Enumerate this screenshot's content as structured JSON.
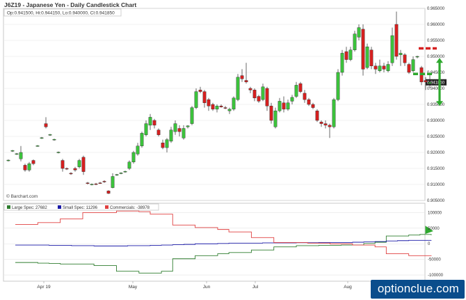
{
  "title": "J6Z19 - Japanese Yen - Daily Candlestick Chart",
  "ohlc_legend": "Op:0.941500, Hi:0.944150, Lo:0.940000, Cl:0.941850",
  "source_label": "© Barchart.com",
  "last_price_label": "0.941850",
  "watermark": "optionclue.com",
  "colors": {
    "up": "#3cc33c",
    "down": "#d62020",
    "large_spec": "#2e7d2e",
    "small_spec": "#1a1aa8",
    "commercials": "#e04040",
    "annotation": "#2ea82e",
    "resistance": "#d62020",
    "support": "#2ea82e",
    "grid": "#e4e4e4",
    "label_bg": "#222222"
  },
  "chart_data": [
    {
      "type": "candlestick",
      "y_ticks": [
        "0.965000",
        "0.960000",
        "0.955000",
        "0.950000",
        "0.945000",
        "0.940000",
        "0.935000",
        "0.930000",
        "0.925000",
        "0.920000",
        "0.915000",
        "0.910000",
        "0.905000"
      ],
      "ylim": [
        0.905,
        0.965
      ],
      "x_ticks": [
        "Apr 19",
        "May",
        "Jun",
        "Jul",
        "Aug"
      ],
      "candles": [
        {
          "o": 0.9175,
          "h": 0.9178,
          "l": 0.9172,
          "c": 0.9176
        },
        {
          "o": 0.9205,
          "h": 0.9208,
          "l": 0.9202,
          "c": 0.9206
        },
        {
          "o": 0.9195,
          "h": 0.9198,
          "l": 0.9192,
          "c": 0.9196
        },
        {
          "o": 0.918,
          "h": 0.922,
          "l": 0.9172,
          "c": 0.92
        },
        {
          "o": 0.916,
          "h": 0.9165,
          "l": 0.914,
          "c": 0.9145
        },
        {
          "o": 0.9145,
          "h": 0.917,
          "l": 0.914,
          "c": 0.9165
        },
        {
          "o": 0.9175,
          "h": 0.9178,
          "l": 0.916,
          "c": 0.9165
        },
        {
          "o": 0.922,
          "h": 0.9223,
          "l": 0.9218,
          "c": 0.9221
        },
        {
          "o": 0.9245,
          "h": 0.9248,
          "l": 0.9242,
          "c": 0.9246
        },
        {
          "o": 0.929,
          "h": 0.931,
          "l": 0.9275,
          "c": 0.928
        },
        {
          "o": 0.9255,
          "h": 0.9258,
          "l": 0.9252,
          "c": 0.9256
        },
        {
          "o": 0.924,
          "h": 0.9243,
          "l": 0.9237,
          "c": 0.9241
        },
        {
          "o": 0.92,
          "h": 0.9203,
          "l": 0.9197,
          "c": 0.9201
        },
        {
          "o": 0.9175,
          "h": 0.918,
          "l": 0.914,
          "c": 0.915
        },
        {
          "o": 0.915,
          "h": 0.9153,
          "l": 0.9145,
          "c": 0.9148
        },
        {
          "o": 0.9135,
          "h": 0.9138,
          "l": 0.913,
          "c": 0.9133
        },
        {
          "o": 0.915,
          "h": 0.9155,
          "l": 0.914,
          "c": 0.9145
        },
        {
          "o": 0.9155,
          "h": 0.918,
          "l": 0.915,
          "c": 0.9175
        },
        {
          "o": 0.9185,
          "h": 0.919,
          "l": 0.913,
          "c": 0.914
        },
        {
          "o": 0.9105,
          "h": 0.9108,
          "l": 0.91,
          "c": 0.9103
        },
        {
          "o": 0.91,
          "h": 0.9103,
          "l": 0.9097,
          "c": 0.9101
        },
        {
          "o": 0.9102,
          "h": 0.9105,
          "l": 0.9098,
          "c": 0.91
        },
        {
          "o": 0.9105,
          "h": 0.9108,
          "l": 0.9102,
          "c": 0.9104
        },
        {
          "o": 0.911,
          "h": 0.9113,
          "l": 0.9105,
          "c": 0.9109
        },
        {
          "o": 0.908,
          "h": 0.9082,
          "l": 0.907,
          "c": 0.9072
        },
        {
          "o": 0.909,
          "h": 0.9135,
          "l": 0.9088,
          "c": 0.9125
        },
        {
          "o": 0.913,
          "h": 0.9133,
          "l": 0.9127,
          "c": 0.9131
        },
        {
          "o": 0.9135,
          "h": 0.9138,
          "l": 0.9132,
          "c": 0.9136
        },
        {
          "o": 0.914,
          "h": 0.9143,
          "l": 0.9137,
          "c": 0.9141
        },
        {
          "o": 0.915,
          "h": 0.9175,
          "l": 0.9145,
          "c": 0.917
        },
        {
          "o": 0.917,
          "h": 0.9205,
          "l": 0.9165,
          "c": 0.92
        },
        {
          "o": 0.9195,
          "h": 0.923,
          "l": 0.919,
          "c": 0.922
        },
        {
          "o": 0.922,
          "h": 0.9265,
          "l": 0.9215,
          "c": 0.926
        },
        {
          "o": 0.9255,
          "h": 0.93,
          "l": 0.925,
          "c": 0.929
        },
        {
          "o": 0.9285,
          "h": 0.932,
          "l": 0.927,
          "c": 0.931
        },
        {
          "o": 0.93,
          "h": 0.9305,
          "l": 0.9275,
          "c": 0.9285
        },
        {
          "o": 0.927,
          "h": 0.9275,
          "l": 0.925,
          "c": 0.9255
        },
        {
          "o": 0.923,
          "h": 0.924,
          "l": 0.921,
          "c": 0.9215
        },
        {
          "o": 0.9215,
          "h": 0.9245,
          "l": 0.92,
          "c": 0.924
        },
        {
          "o": 0.9235,
          "h": 0.928,
          "l": 0.923,
          "c": 0.927
        },
        {
          "o": 0.9265,
          "h": 0.93,
          "l": 0.9255,
          "c": 0.929
        },
        {
          "o": 0.9275,
          "h": 0.9285,
          "l": 0.925,
          "c": 0.9265
        },
        {
          "o": 0.9245,
          "h": 0.9285,
          "l": 0.924,
          "c": 0.9275
        },
        {
          "o": 0.928,
          "h": 0.9285,
          "l": 0.9275,
          "c": 0.9283
        },
        {
          "o": 0.929,
          "h": 0.9345,
          "l": 0.9285,
          "c": 0.934
        },
        {
          "o": 0.934,
          "h": 0.94,
          "l": 0.9335,
          "c": 0.939
        },
        {
          "o": 0.9395,
          "h": 0.9405,
          "l": 0.9385,
          "c": 0.939
        },
        {
          "o": 0.939,
          "h": 0.9395,
          "l": 0.934,
          "c": 0.9355
        },
        {
          "o": 0.9365,
          "h": 0.937,
          "l": 0.933,
          "c": 0.9345
        },
        {
          "o": 0.935,
          "h": 0.9355,
          "l": 0.933,
          "c": 0.9335
        },
        {
          "o": 0.9335,
          "h": 0.935,
          "l": 0.9325,
          "c": 0.9345
        },
        {
          "o": 0.9345,
          "h": 0.935,
          "l": 0.934,
          "c": 0.9342
        },
        {
          "o": 0.934,
          "h": 0.9345,
          "l": 0.9335,
          "c": 0.9338
        },
        {
          "o": 0.933,
          "h": 0.934,
          "l": 0.932,
          "c": 0.9335
        },
        {
          "o": 0.9335,
          "h": 0.9375,
          "l": 0.933,
          "c": 0.937
        },
        {
          "o": 0.9365,
          "h": 0.9445,
          "l": 0.936,
          "c": 0.9435
        },
        {
          "o": 0.944,
          "h": 0.946,
          "l": 0.942,
          "c": 0.943
        },
        {
          "o": 0.9425,
          "h": 0.948,
          "l": 0.9415,
          "c": 0.942
        },
        {
          "o": 0.94,
          "h": 0.9405,
          "l": 0.9385,
          "c": 0.9395
        },
        {
          "o": 0.9395,
          "h": 0.94,
          "l": 0.936,
          "c": 0.937
        },
        {
          "o": 0.9375,
          "h": 0.938,
          "l": 0.9355,
          "c": 0.936
        },
        {
          "o": 0.9365,
          "h": 0.9415,
          "l": 0.936,
          "c": 0.9405
        },
        {
          "o": 0.94,
          "h": 0.9405,
          "l": 0.933,
          "c": 0.9345
        },
        {
          "o": 0.9345,
          "h": 0.9355,
          "l": 0.929,
          "c": 0.93
        },
        {
          "o": 0.928,
          "h": 0.934,
          "l": 0.9275,
          "c": 0.933
        },
        {
          "o": 0.933,
          "h": 0.937,
          "l": 0.9325,
          "c": 0.936
        },
        {
          "o": 0.9355,
          "h": 0.9375,
          "l": 0.9325,
          "c": 0.9335
        },
        {
          "o": 0.9335,
          "h": 0.9365,
          "l": 0.933,
          "c": 0.9355
        },
        {
          "o": 0.936,
          "h": 0.938,
          "l": 0.935,
          "c": 0.9372
        },
        {
          "o": 0.9375,
          "h": 0.942,
          "l": 0.937,
          "c": 0.941
        },
        {
          "o": 0.9415,
          "h": 0.942,
          "l": 0.9385,
          "c": 0.939
        },
        {
          "o": 0.9385,
          "h": 0.9395,
          "l": 0.9355,
          "c": 0.9365
        },
        {
          "o": 0.9365,
          "h": 0.937,
          "l": 0.9345,
          "c": 0.935
        },
        {
          "o": 0.935,
          "h": 0.9355,
          "l": 0.9335,
          "c": 0.934
        },
        {
          "o": 0.933,
          "h": 0.9335,
          "l": 0.9295,
          "c": 0.93
        },
        {
          "o": 0.9295,
          "h": 0.93,
          "l": 0.928,
          "c": 0.929
        },
        {
          "o": 0.929,
          "h": 0.93,
          "l": 0.9275,
          "c": 0.9285
        },
        {
          "o": 0.9285,
          "h": 0.929,
          "l": 0.9245,
          "c": 0.928
        },
        {
          "o": 0.928,
          "h": 0.937,
          "l": 0.9275,
          "c": 0.9365
        },
        {
          "o": 0.9365,
          "h": 0.946,
          "l": 0.936,
          "c": 0.945
        },
        {
          "o": 0.945,
          "h": 0.952,
          "l": 0.944,
          "c": 0.951
        },
        {
          "o": 0.9515,
          "h": 0.953,
          "l": 0.948,
          "c": 0.949
        },
        {
          "o": 0.949,
          "h": 0.953,
          "l": 0.9485,
          "c": 0.952
        },
        {
          "o": 0.952,
          "h": 0.958,
          "l": 0.9515,
          "c": 0.957
        },
        {
          "o": 0.956,
          "h": 0.96,
          "l": 0.955,
          "c": 0.959
        },
        {
          "o": 0.9585,
          "h": 0.96,
          "l": 0.944,
          "c": 0.946
        },
        {
          "o": 0.9465,
          "h": 0.954,
          "l": 0.946,
          "c": 0.953
        },
        {
          "o": 0.952,
          "h": 0.953,
          "l": 0.946,
          "c": 0.947
        },
        {
          "o": 0.947,
          "h": 0.948,
          "l": 0.9445,
          "c": 0.946
        },
        {
          "o": 0.9455,
          "h": 0.949,
          "l": 0.945,
          "c": 0.947
        },
        {
          "o": 0.947,
          "h": 0.948,
          "l": 0.945,
          "c": 0.946
        },
        {
          "o": 0.9455,
          "h": 0.9485,
          "l": 0.945,
          "c": 0.9475
        },
        {
          "o": 0.948,
          "h": 0.959,
          "l": 0.947,
          "c": 0.9565
        },
        {
          "o": 0.96,
          "h": 0.964,
          "l": 0.949,
          "c": 0.95
        },
        {
          "o": 0.9505,
          "h": 0.952,
          "l": 0.947,
          "c": 0.951
        },
        {
          "o": 0.9505,
          "h": 0.951,
          "l": 0.947,
          "c": 0.948
        },
        {
          "o": 0.9475,
          "h": 0.948,
          "l": 0.9445,
          "c": 0.945
        },
        {
          "o": 0.9455,
          "h": 0.95,
          "l": 0.945,
          "c": 0.949
        },
        {
          "o": 0.9498,
          "h": 0.9502,
          "l": 0.9494,
          "c": 0.95
        },
        {
          "o": 0.9465,
          "h": 0.947,
          "l": 0.941,
          "c": 0.942
        },
        {
          "o": 0.9425,
          "h": 0.9435,
          "l": 0.9395,
          "c": 0.942
        },
        {
          "o": 0.9415,
          "h": 0.9442,
          "l": 0.94,
          "c": 0.9419
        }
      ],
      "annotations": {
        "resistance_level": 0.9525,
        "support_level": 0.9445
      }
    },
    {
      "type": "line",
      "y_ticks": [
        "100000",
        "50000",
        "0",
        "-50000",
        "-100000"
      ],
      "ylim": [
        -120000,
        130000
      ],
      "series": [
        {
          "name": "Large Spec: 27682",
          "color_key": "large_spec",
          "values": [
            -60000,
            -60000,
            -62000,
            -63000,
            -65000,
            -65000,
            -65000,
            -70000,
            -70000,
            -88000,
            -88000,
            -94000,
            -94000,
            -88000,
            -48000,
            -48000,
            -38000,
            -38000,
            -32000,
            -28000,
            -28000,
            -20000,
            -20000,
            -10000,
            -10000,
            -6000,
            -6000,
            -5000,
            -5000,
            -4000,
            -4000,
            1000,
            5000,
            25000,
            25000,
            28000,
            30000,
            27682
          ]
        },
        {
          "name": "Small Spec: 11296",
          "color_key": "small_spec",
          "values": [
            -4000,
            -4000,
            -4000,
            -5000,
            -5000,
            -6000,
            -6000,
            -7000,
            -7000,
            -7000,
            -6000,
            -6000,
            -5000,
            -4000,
            -3000,
            -2000,
            0,
            0,
            1000,
            2000,
            2000,
            2000,
            3000,
            3000,
            3000,
            3500,
            3500,
            4000,
            4000,
            4000,
            5000,
            6000,
            7000,
            9000,
            10000,
            11000,
            11000,
            11296
          ]
        },
        {
          "name": "Commercials: -38978",
          "color_key": "commercials",
          "values": [
            62000,
            62000,
            68000,
            68000,
            80000,
            80000,
            100000,
            100000,
            100000,
            105000,
            105000,
            103000,
            95000,
            95000,
            60000,
            60000,
            52000,
            52000,
            46000,
            38000,
            38000,
            20000,
            20000,
            4000,
            4000,
            4000,
            2000,
            2000,
            0,
            0,
            -4000,
            -4000,
            -10000,
            -32000,
            -32000,
            -38000,
            -38000,
            -38978
          ]
        }
      ]
    }
  ]
}
